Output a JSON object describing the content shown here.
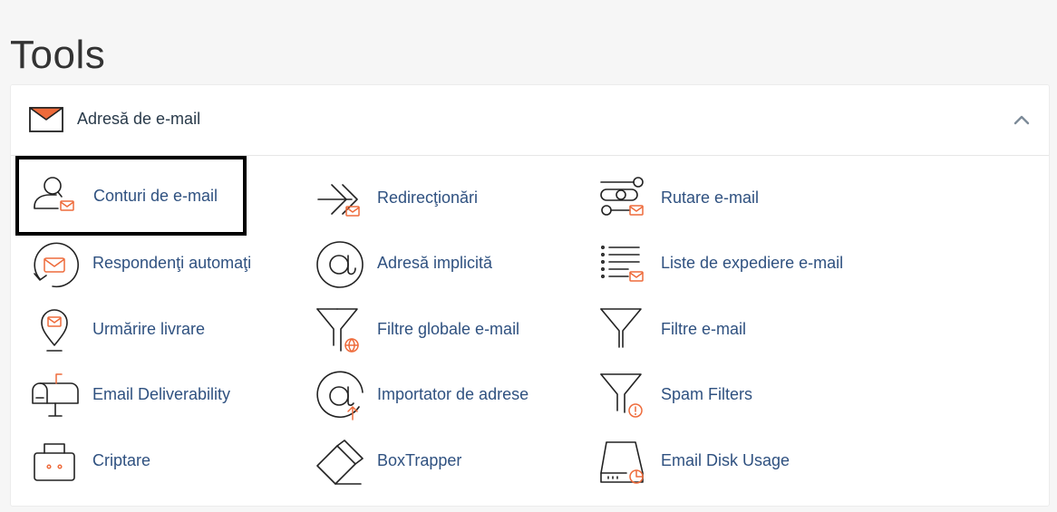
{
  "page": {
    "title": "Tools"
  },
  "section": {
    "title": "Adresă de e-mail",
    "icon": "envelope-icon",
    "state": "expanded",
    "accent_color": "#ee6b3b",
    "link_color": "#2f5180"
  },
  "tools": [
    {
      "label": "Conturi de e-mail",
      "icon": "email-accounts-icon",
      "selected": true
    },
    {
      "label": "Redirecţionări",
      "icon": "forwarders-icon"
    },
    {
      "label": "Rutare e-mail",
      "icon": "email-routing-icon"
    },
    {
      "label": "Respondenţi automaţi",
      "icon": "autoresponders-icon"
    },
    {
      "label": "Adresă implicită",
      "icon": "default-address-icon"
    },
    {
      "label": "Liste de expediere e-mail",
      "icon": "mailing-lists-icon"
    },
    {
      "label": "Urmărire livrare",
      "icon": "track-delivery-icon"
    },
    {
      "label": "Filtre globale e-mail",
      "icon": "global-filters-icon"
    },
    {
      "label": "Filtre e-mail",
      "icon": "email-filters-icon"
    },
    {
      "label": "Email Deliverability",
      "icon": "mailbox-icon"
    },
    {
      "label": "Importator de adrese",
      "icon": "address-importer-icon"
    },
    {
      "label": "Spam Filters",
      "icon": "spam-filter-icon"
    },
    {
      "label": "Criptare",
      "icon": "encryption-icon"
    },
    {
      "label": "BoxTrapper",
      "icon": "boxtrapper-icon"
    },
    {
      "label": "Email Disk Usage",
      "icon": "disk-usage-icon"
    }
  ]
}
